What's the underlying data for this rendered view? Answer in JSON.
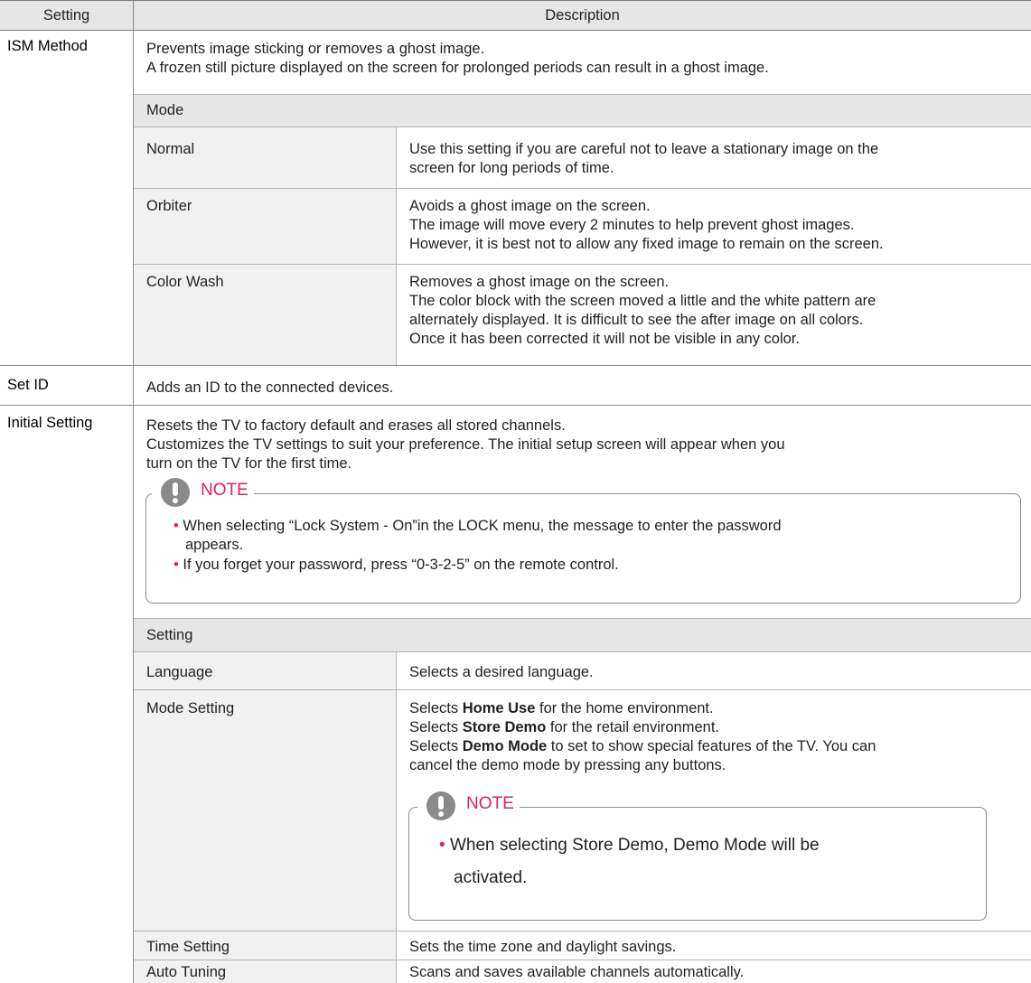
{
  "table": {
    "headers": {
      "setting": "Setting",
      "description": "Description"
    }
  },
  "ism": {
    "name": "ISM Method",
    "desc_line1": "Prevents image sticking or removes a ghost image.",
    "desc_line2": "A frozen still picture displayed on the screen for prolonged periods can result in a ghost image.",
    "mode_header": "Mode",
    "modes": [
      {
        "name": "Normal",
        "lines": [
          "Use this setting if you are careful not to leave a stationary image on the",
          "screen for long periods of time."
        ]
      },
      {
        "name": "Orbiter",
        "lines": [
          "Avoids a ghost image on the screen.",
          "The image will move every 2 minutes to help prevent ghost images.",
          "However, it is best not to allow any fixed image to remain on the screen."
        ]
      },
      {
        "name": "Color Wash",
        "lines": [
          "Removes a ghost image on the screen.",
          "The color block with the screen moved a little and the white pattern are",
          "alternately displayed. It is difficult to see the after image on all colors.",
          "Once it has been corrected it will not be visible in any color."
        ]
      }
    ]
  },
  "setid": {
    "name": "Set ID",
    "desc": "Adds an ID to the connected devices."
  },
  "initial": {
    "name": "Initial Setting",
    "desc_line1": "Resets the TV to factory default and erases all stored channels.",
    "desc_line2": "Customizes the TV settings to suit your preference. The initial setup screen will appear when you",
    "desc_line3": "turn on the TV for the first time.",
    "note": {
      "label": "NOTE",
      "bullet1_line1": "When selecting “Lock System - On”in the LOCK menu, the message to enter the password",
      "bullet1_line2": "appears.",
      "bullet2": "If you forget your password, press “0-3-2-5” on the remote control."
    },
    "setting_header": "Setting",
    "language": {
      "name": "Language",
      "desc": "Selects a desired language."
    },
    "mode_setting": {
      "name": "Mode Setting",
      "l1_pre": "Selects ",
      "l1_bold": "Home Use",
      "l1_post": " for the home environment.",
      "l2_pre": "Selects ",
      "l2_bold": "Store Demo",
      "l2_post": " for the retail environment.",
      "l3_pre": "Selects ",
      "l3_bold": "Demo Mode",
      "l3_post": " to set to show special features of the TV. You can",
      "l4": "cancel the demo mode by pressing any buttons.",
      "note": {
        "label": "NOTE",
        "bullet_line1": "When selecting Store Demo, Demo Mode will be",
        "bullet_line2": "activated."
      }
    },
    "time_setting": {
      "name": "Time Setting",
      "desc": "Sets the time zone and daylight savings."
    },
    "auto_tuning": {
      "name": "Auto Tuning",
      "desc": "Scans and saves available channels automatically."
    }
  },
  "colors": {
    "header_bg": "#e6e6e6",
    "note_accent": "#d6245c"
  }
}
